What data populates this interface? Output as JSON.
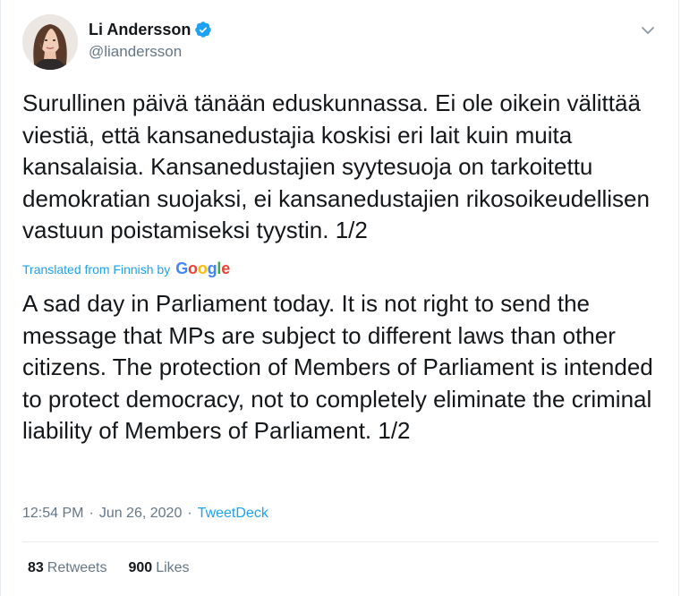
{
  "author": {
    "name": "Li Andersson",
    "handle": "@liandersson",
    "verified": true,
    "avatar_icon": "profile-photo"
  },
  "tweet": {
    "text": "Surullinen päivä tänään eduskunnassa. Ei ole oikein välittää viestiä, että kansanedustajia koskisi eri lait kuin muita kansalaisia. Kansanedustajien syytesuoja on tarkoitettu demokratian suojaksi, ei kansanedustajien rikosoikeudellisen vastuun poistamiseksi tyystin. 1/2",
    "translated_label": "Translated from Finnish by",
    "translation_provider": "Google",
    "translation": "A sad day in Parliament today. It is not right to send the message that MPs are subject to different laws than other citizens. The protection of Members of Parliament is intended to protect democracy, not to completely eliminate the criminal liability of Members of Parliament. 1/2"
  },
  "meta": {
    "time": "12:54 PM",
    "separator": "·",
    "date": "Jun 26, 2020",
    "source": "TweetDeck"
  },
  "stats": {
    "retweets_count": "83",
    "retweets_label": "Retweets",
    "likes_count": "900",
    "likes_label": "Likes"
  },
  "colors": {
    "accent": "#1da1f2",
    "text": "#14171a",
    "muted": "#657786",
    "divider": "#e6ecf0"
  },
  "icons": {
    "verified": "verified-badge-icon",
    "menu": "chevron-down-icon"
  }
}
